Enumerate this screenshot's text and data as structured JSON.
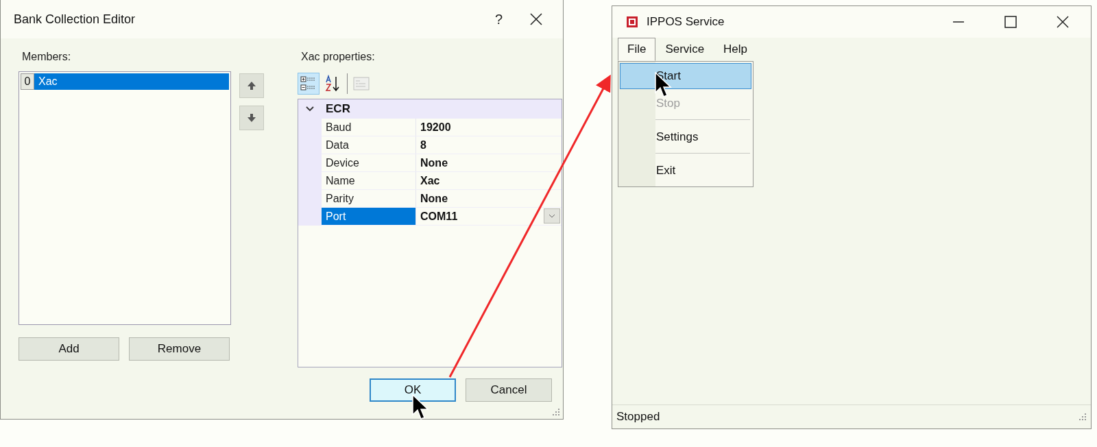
{
  "dialog": {
    "title": "Bank Collection Editor",
    "help": "?",
    "members_label": "Members:",
    "members": [
      {
        "index": "0",
        "name": "Xac",
        "selected": true
      }
    ],
    "add_button": "Add",
    "remove_button": "Remove",
    "properties_label": "Xac properties:",
    "toolbar": [
      {
        "kind": "categorized",
        "selected": true,
        "disabled": false
      },
      {
        "kind": "alphabetical",
        "selected": false,
        "disabled": false
      },
      {
        "kind": "pages",
        "selected": false,
        "disabled": true
      }
    ],
    "category": {
      "name": "ECR",
      "expanded": true
    },
    "properties": [
      {
        "name": "Baud",
        "value": "19200",
        "selected": false
      },
      {
        "name": "Data",
        "value": "8",
        "selected": false
      },
      {
        "name": "Device",
        "value": "None",
        "selected": false
      },
      {
        "name": "Name",
        "value": "Xac",
        "selected": false
      },
      {
        "name": "Parity",
        "value": "None",
        "selected": false
      },
      {
        "name": "Port",
        "value": "COM11",
        "selected": true
      }
    ],
    "ok_button": "OK",
    "cancel_button": "Cancel"
  },
  "service_window": {
    "title": "IPPOS Service",
    "menu": [
      {
        "label": "File",
        "selected": true
      },
      {
        "label": "Service",
        "selected": false
      },
      {
        "label": "Help",
        "selected": false
      }
    ],
    "file_menu": [
      {
        "kind": "item",
        "label": "Start",
        "selected": true,
        "disabled": false
      },
      {
        "kind": "item",
        "label": "Stop",
        "selected": false,
        "disabled": true
      },
      {
        "kind": "separator"
      },
      {
        "kind": "item",
        "label": "Settings",
        "selected": false,
        "disabled": false
      },
      {
        "kind": "separator"
      },
      {
        "kind": "item",
        "label": "Exit",
        "selected": false,
        "disabled": false
      }
    ],
    "status": "Stopped"
  }
}
